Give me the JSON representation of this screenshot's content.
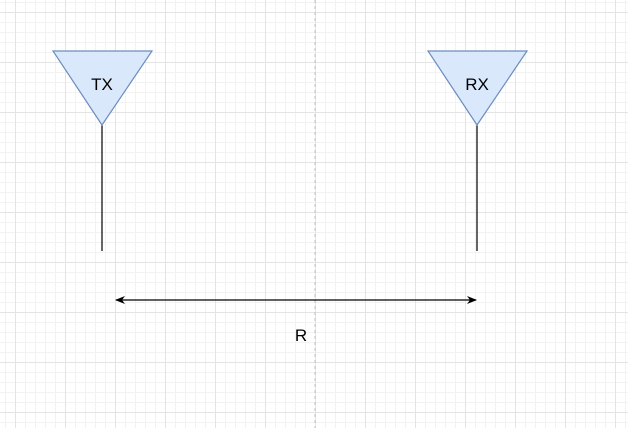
{
  "diagram": {
    "transmitter": {
      "label": "TX"
    },
    "receiver": {
      "label": "RX"
    },
    "distance": {
      "label": "R"
    }
  },
  "colors": {
    "antenna_fill": "#dae8fc",
    "antenna_stroke": "#6c8ebf",
    "line": "#000000",
    "guide": "#c0c0c0"
  },
  "icons": {
    "antenna": "antenna-triangle-icon",
    "distance": "double-arrow-icon"
  }
}
